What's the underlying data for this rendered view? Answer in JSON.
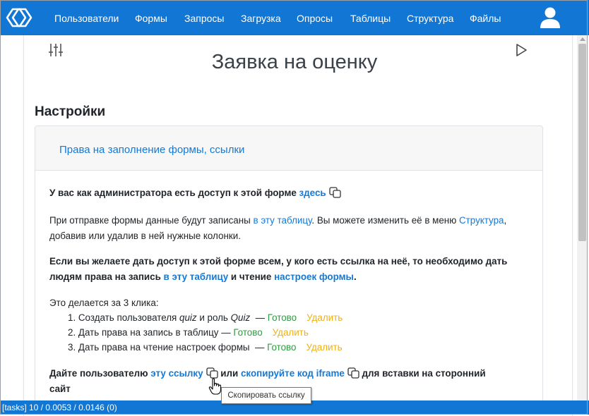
{
  "nav": {
    "items": [
      "Пользователи",
      "Формы",
      "Запросы",
      "Загрузка",
      "Опросы",
      "Таблицы",
      "Структура",
      "Файлы"
    ]
  },
  "page": {
    "title": "Заявка на оценку"
  },
  "settings": {
    "heading": "Настройки",
    "panel_link": "Права на заполнение формы, ссылки",
    "admin_line": {
      "text": "У вас как администратора есть доступ к этой форме ",
      "link": "здесь"
    },
    "info": {
      "part1": "При отправке формы данные будут записаны ",
      "link_table": "в эту таблицу",
      "part2": ". Вы можете изменить её в меню ",
      "link_structure": "Структура",
      "part3": ",",
      "line2": "добавив или удалив в ней нужные колонки."
    },
    "access": {
      "line1": "Если вы желаете дать доступ к этой форме всем, у кого есть ссылка на неё, то необходимо дать",
      "line2_part1": "людям права на запись ",
      "link_table": "в эту таблицу",
      "line2_part2": " и чтение ",
      "link_settings": "настроек формы",
      "line2_part3": "."
    },
    "clicks_intro": "Это делается за 3 клика:",
    "steps": [
      {
        "prefix": "1. Создать пользователя ",
        "em1": "quiz",
        "mid": " и роль ",
        "em2": "Quiz",
        "dash": "  — ",
        "done": "Готово",
        "delete": "Удалить"
      },
      {
        "text": "2. Дать права на запись в таблицу — ",
        "done": "Готово",
        "delete": "Удалить"
      },
      {
        "text": "3. Дать права на чтение настроек формы  — ",
        "done": "Готово",
        "delete": "Удалить"
      }
    ],
    "share": {
      "part1": "Дайте пользователю ",
      "link1": "эту ссылку",
      "part2": " или ",
      "link2": "скопируйте код iframe",
      "part3": " для вставки на сторонний",
      "line2": "сайт"
    },
    "tooltip": "Скопировать ссылку"
  },
  "status_bar": "[tasks] 10 / 0.0053 / 0.0146 (0)",
  "colors": {
    "nav": "#1176d4",
    "link": "#1479d6",
    "done": "#2e9c3f",
    "delete": "#f0b110"
  },
  "icons": [
    "logo-icon",
    "user-icon",
    "sliders-icon",
    "play-icon",
    "copy-icon",
    "hand-cursor-icon"
  ]
}
